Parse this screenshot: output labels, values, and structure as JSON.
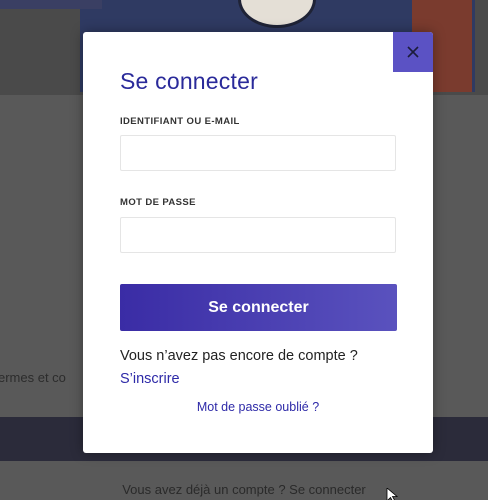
{
  "background": {
    "left_text": "ermes et co",
    "footer_text": "Vous avez déjà un compte ? Se connecter"
  },
  "login_modal": {
    "title": "Se connecter",
    "close_icon": "close-icon",
    "username_label": "IDENTIFIANT OU E-MAIL",
    "username_value": "",
    "password_label": "MOT DE PASSE",
    "password_value": "",
    "submit_label": "Se connecter",
    "no_account_text": "Vous n’avez pas encore de compte ?",
    "register_label": "S’inscrire",
    "forgot_password_label": "Mot de passe oublié ?"
  },
  "colors": {
    "accent": "#5b52c4",
    "title": "#2a2a9a",
    "link": "#2e2aa8",
    "button_gradient_start": "#3a2ca5",
    "button_gradient_end": "#5a52be"
  }
}
